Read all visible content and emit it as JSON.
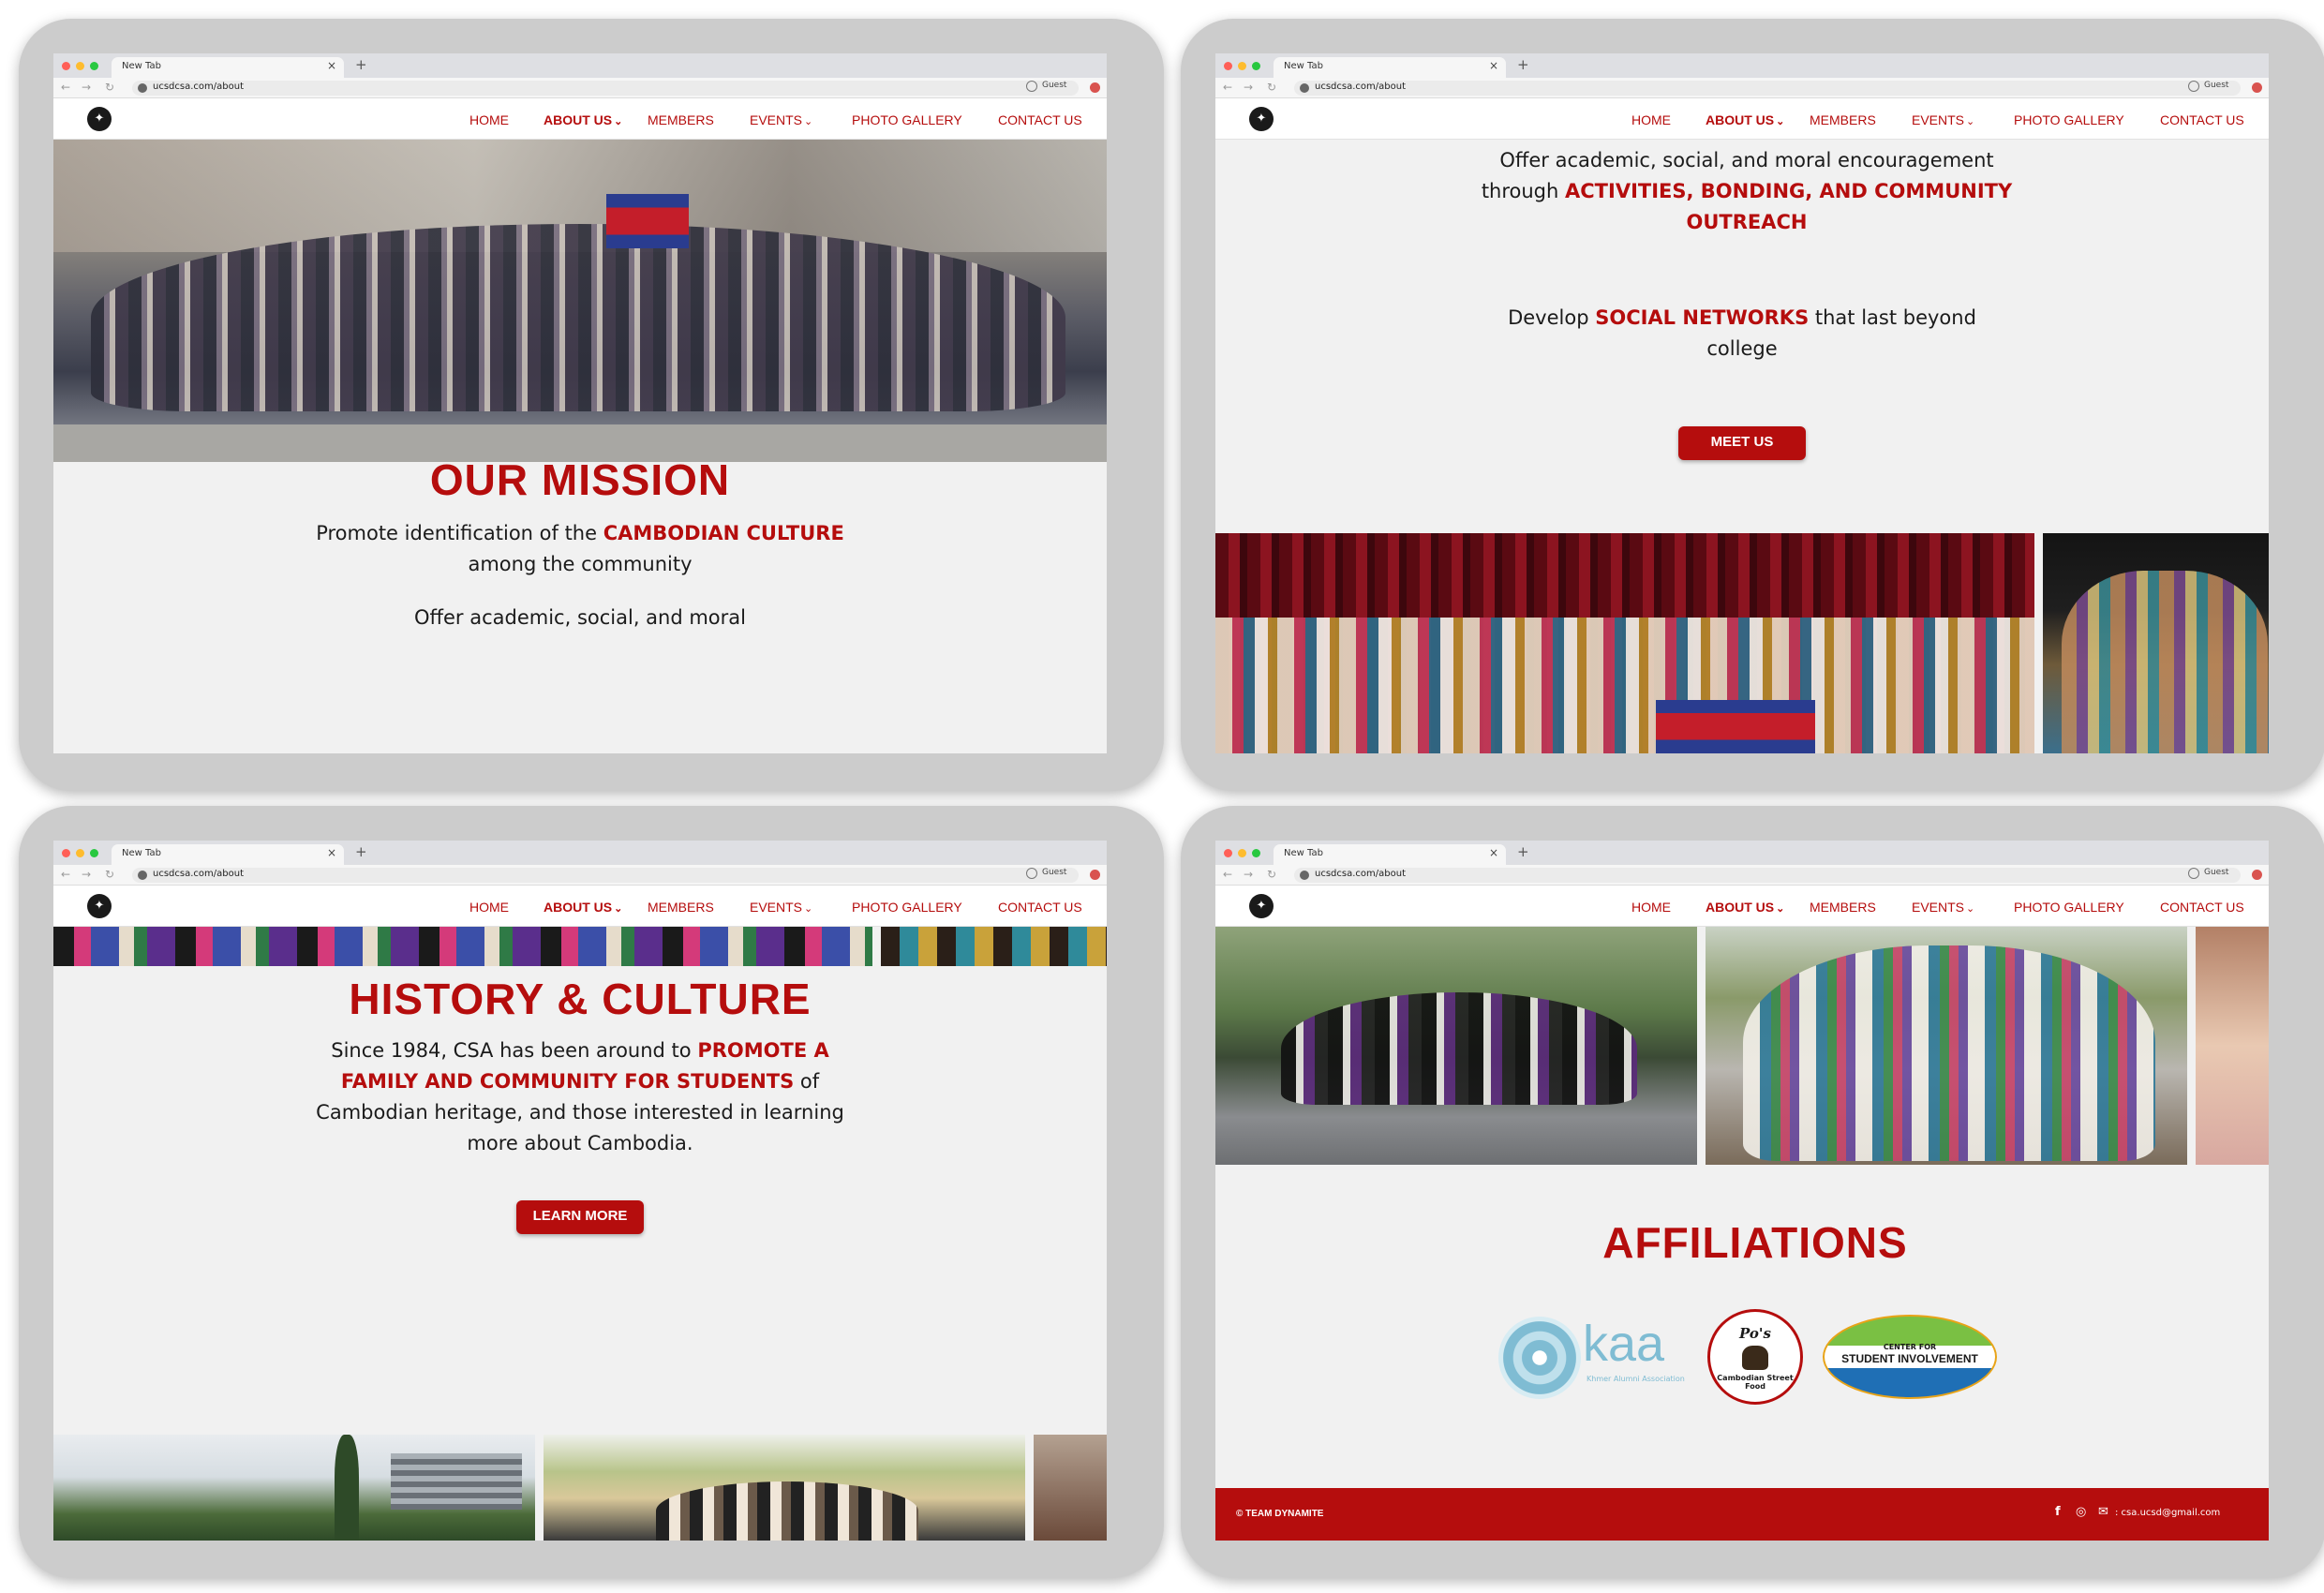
{
  "browser": {
    "tab_title": "New Tab",
    "tab_close": "×",
    "new_tab": "+",
    "url": "ucsdcsa.com/about",
    "profile": "Guest",
    "back": "←",
    "forward": "→",
    "reload": "↻"
  },
  "nav": {
    "logo_glyph": "✦",
    "items": [
      "HOME",
      "ABOUT US",
      "MEMBERS",
      "EVENTS",
      "PHOTO GALLERY",
      "CONTACT US"
    ],
    "chevron": "⌄"
  },
  "mission": {
    "title": "OUR MISSION",
    "p1_a": "Promote identification of the ",
    "p1_red": "CAMBODIAN CULTURE",
    "p1_b": " among the community",
    "p2_peek": "Offer academic, social, and moral",
    "p2_a": "Offer academic, social, and moral encouragement through ",
    "p2_red": "ACTIVITIES,  BONDING, AND COMMUNITY OUTREACH",
    "p3_a": "Develop ",
    "p3_red": "SOCIAL NETWORKS",
    "p3_b": " that last beyond college",
    "button": "MEET US"
  },
  "history": {
    "title": "HISTORY & CULTURE",
    "p_a": "Since 1984, CSA has been around to ",
    "p_red": "PROMOTE A FAMILY AND COMMUNITY FOR STUDENTS",
    "p_b": " of Cambodian heritage, and  those interested in learning more about Cambodia.",
    "button": "LEARN MORE"
  },
  "affiliations": {
    "title": "AFFILIATIONS",
    "kaa_logo": "kaa",
    "kaa_sub": "Khmer Alumni Association",
    "pos_logo": "Po's",
    "pos_sub": "Cambodian Street Food",
    "csi_top": "CENTER FOR",
    "csi_main": "STUDENT INVOLVEMENT"
  },
  "footer": {
    "credit": "© TEAM DYNAMITE",
    "facebook": "f",
    "instagram": "◎",
    "email_icon": "✉",
    "email": ": csa.ucsd@gmail.com"
  },
  "colors": {
    "brand_red": "#b50d0d",
    "page_bg": "#f1f1f1",
    "frame": "#cccccc"
  }
}
